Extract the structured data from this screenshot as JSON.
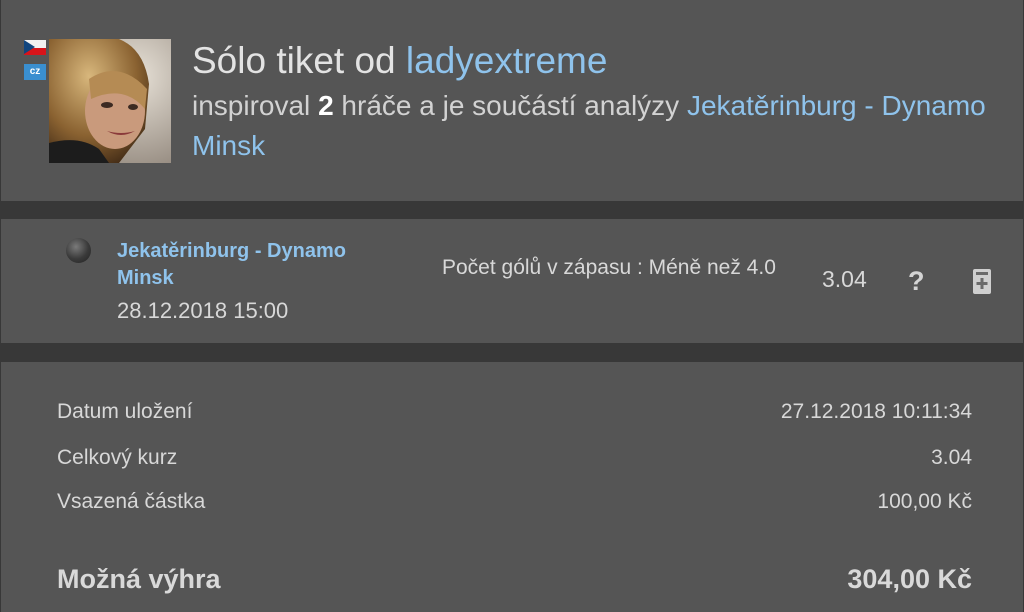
{
  "header": {
    "country_code": "cz",
    "title_prefix": "Sólo tiket od",
    "username": "ladyextreme",
    "subtitle_prefix": "inspiroval",
    "inspired_count": "2",
    "subtitle_middle": "hráče a je součástí analýzy",
    "analysis_link": "Jekatěrinburg - Dynamo Minsk"
  },
  "bet": {
    "match": "Jekatěrinburg - Dynamo Minsk",
    "datetime": "28.12.2018 15:00",
    "market": "Počet gólů v zápasu : Méně než 4.0",
    "odd": "3.04",
    "help_symbol": "?",
    "help_icon": "question-icon",
    "add_icon": "add-to-ticket-icon",
    "status_icon": "status-dot-icon"
  },
  "summary": {
    "saved_label": "Datum uložení",
    "saved_value": "27.12.2018 10:11:34",
    "total_odds_label": "Celkový kurz",
    "total_odds_value": "3.04",
    "stake_label": "Vsazená částka",
    "stake_value": "100,00 Kč",
    "win_label": "Možná výhra",
    "win_value": "304,00 Kč"
  },
  "colors": {
    "background": "#383838",
    "panel": "#555555",
    "link": "#8fc3ec"
  }
}
